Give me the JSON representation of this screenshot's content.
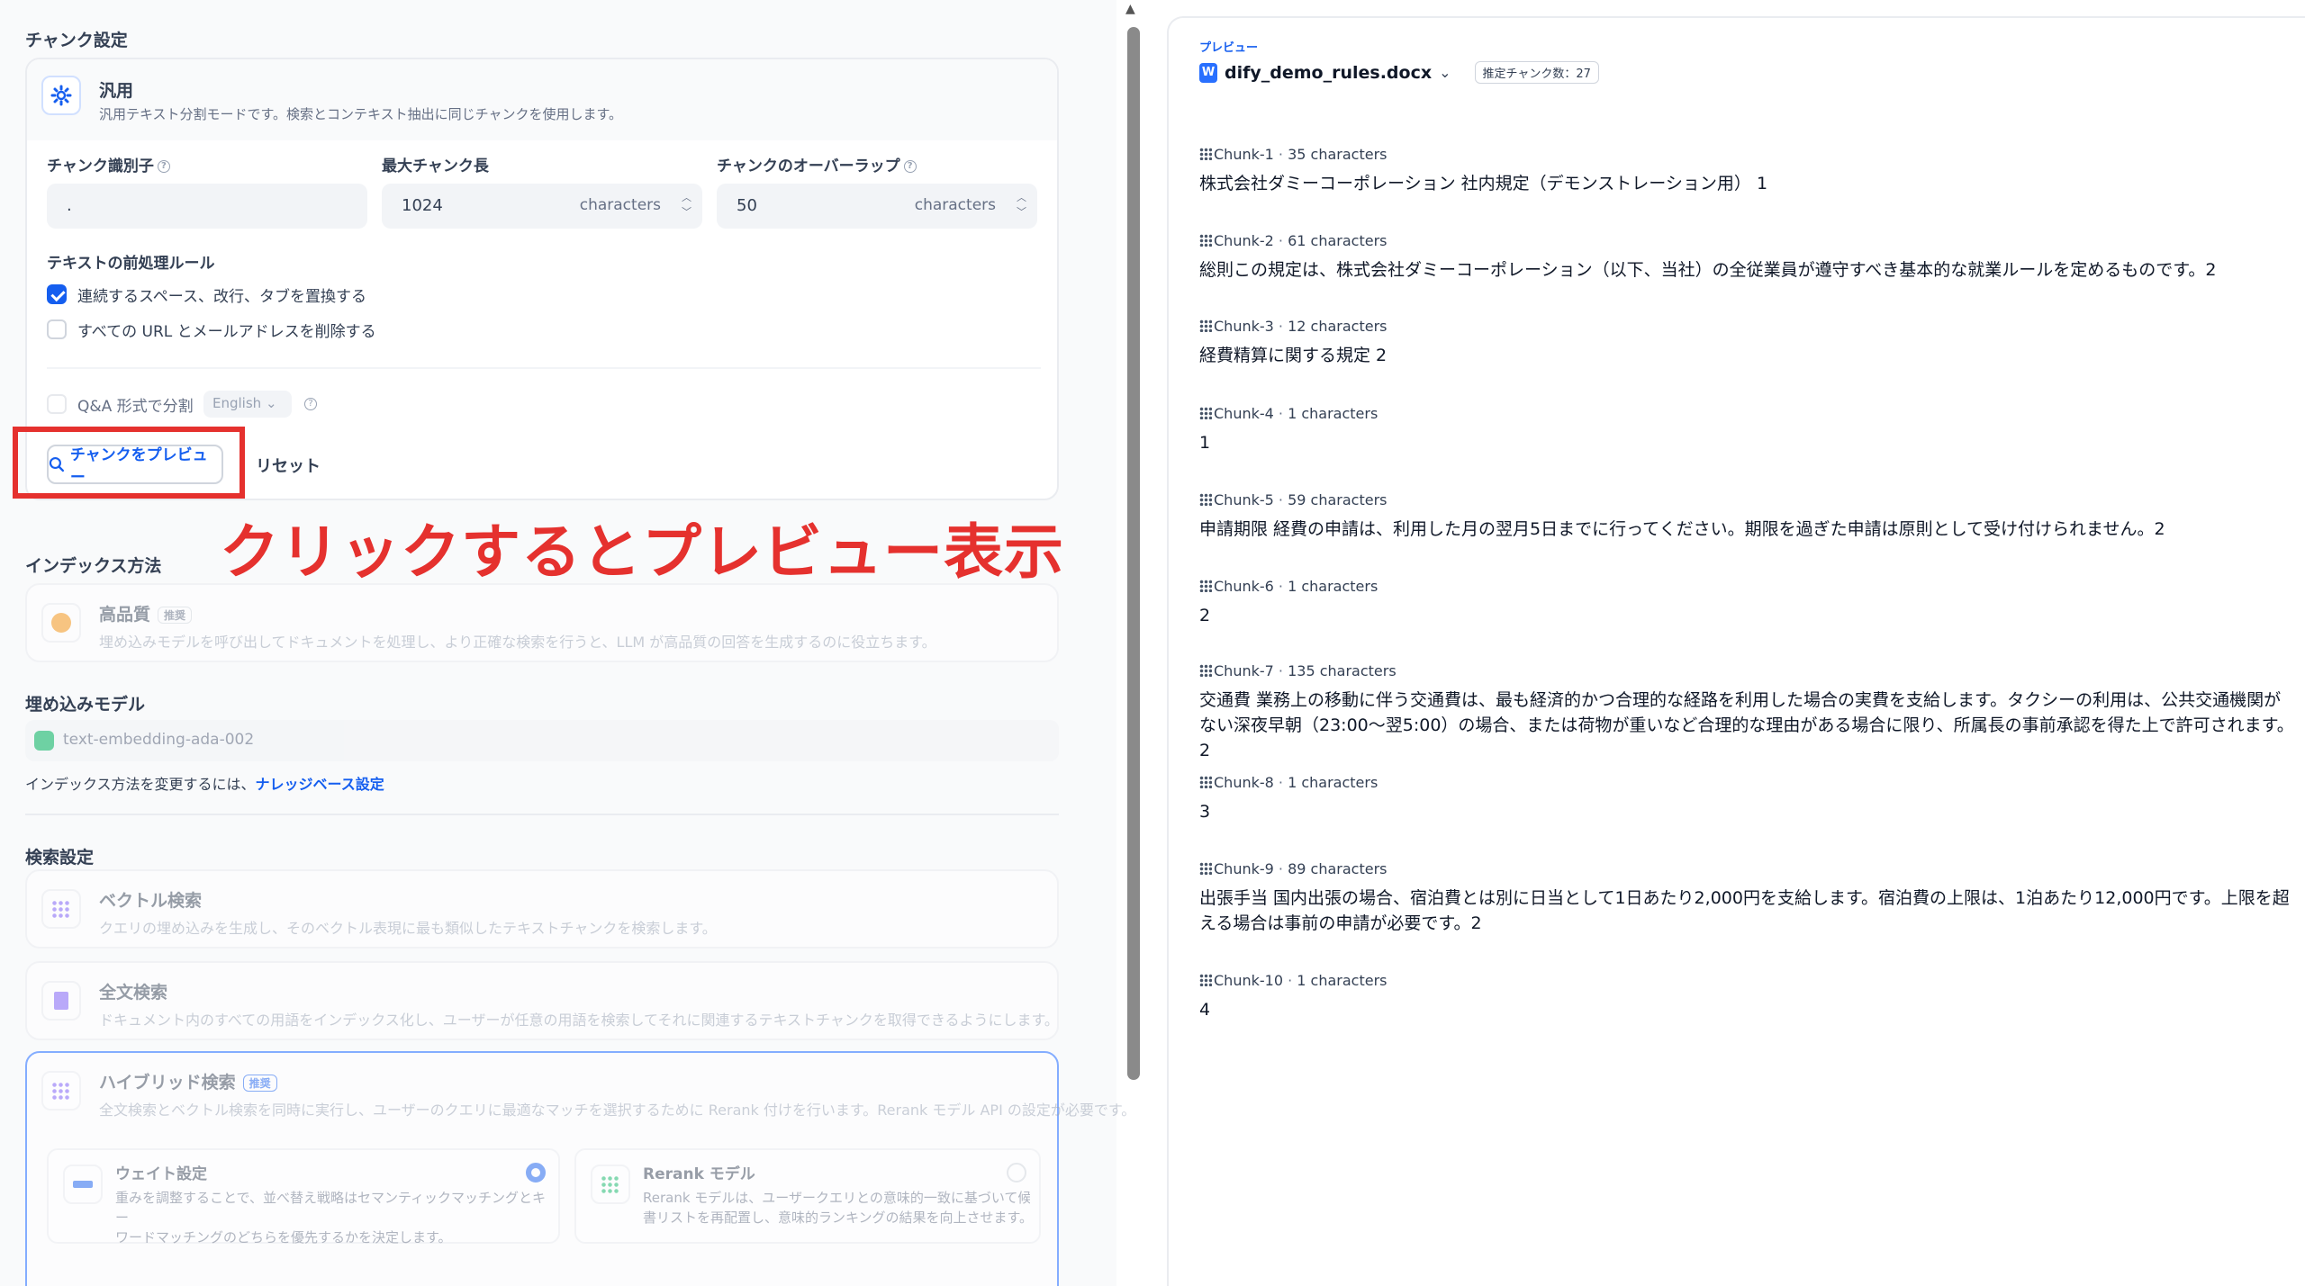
{
  "chunk_settings": {
    "section_title": "チャンク設定",
    "general": {
      "icon": "gear-icon",
      "title": "汎用",
      "desc": "汎用テキスト分割モードです。検索とコンテキスト抽出に同じチャンクを使用します。"
    },
    "delimiter": {
      "label": "チャンク識別子",
      "value": "."
    },
    "max_length": {
      "label": "最大チャンク長",
      "value": "1024",
      "unit": "characters"
    },
    "overlap": {
      "label": "チャンクのオーバーラップ",
      "value": "50",
      "unit": "characters"
    },
    "preprocess_title": "テキストの前処理ルール",
    "rule_spaces": {
      "label": "連続するスペース、改行、タブを置換する",
      "checked": true
    },
    "rule_urls": {
      "label": "すべての URL とメールアドレスを削除する",
      "checked": false
    },
    "qa": {
      "label": "Q&A 形式で分割",
      "language": "English"
    },
    "preview_button": "チャンクをプレビュー",
    "reset_button": "リセット"
  },
  "annotation": {
    "text": "クリックするとプレビュー表示",
    "color": "#e5312e"
  },
  "index_method": {
    "section_title": "インデックス方法",
    "high_quality": {
      "title": "高品質",
      "badge": "推奨",
      "desc": "埋め込みモデルを呼び出してドキュメントを処理し、より正確な検索を行うと、LLM が高品質の回答を生成するのに役立ちます。"
    }
  },
  "embedding": {
    "section_title": "埋め込みモデル",
    "model": "text-embedding-ada-002",
    "note_prefix": "インデックス方法を変更するには、",
    "note_link": "ナレッジベース設定"
  },
  "retrieval": {
    "section_title": "検索設定",
    "vector": {
      "title": "ベクトル検索",
      "desc": "クエリの埋め込みを生成し、そのベクトル表現に最も類似したテキストチャンクを検索します。"
    },
    "fulltext": {
      "title": "全文検索",
      "desc": "ドキュメント内のすべての用語をインデックス化し、ユーザーが任意の用語を検索してそれに関連するテキストチャンクを取得できるようにします。"
    },
    "hybrid": {
      "title": "ハイブリッド検索",
      "badge": "推奨",
      "desc": "全文検索とベクトル検索を同時に実行し、ユーザーのクエリに最適なマッチを選択するために Rerank 付けを行います。Rerank モデル API の設定が必要です。"
    },
    "weight": {
      "title": "ウェイト設定",
      "desc1": "重みを調整することで、並べ替え戦略はセマンティックマッチングとキー",
      "desc2": "ワードマッチングのどちらを優先するかを決定します。"
    },
    "rerank": {
      "title": "Rerank モデル",
      "desc1": "Rerank モデルは、ユーザークエリとの意味的一致に基づいて候補文",
      "desc2": "書リストを再配置し、意味的ランキングの結果を向上させます。"
    }
  },
  "preview": {
    "label": "プレビュー",
    "file": "dify_demo_rules.docx",
    "estimate": "推定チャンク数：27",
    "chunks": [
      {
        "title": "Chunk-1",
        "size": "35 characters",
        "text": "株式会社ダミーコーポレーション 社内規定（デモンストレーション用） 1"
      },
      {
        "title": "Chunk-2",
        "size": "61 characters",
        "text": "総則この規定は、株式会社ダミーコーポレーション（以下、当社）の全従業員が遵守すべき基本的な就業ルールを定めるものです。2"
      },
      {
        "title": "Chunk-3",
        "size": "12 characters",
        "text": "経費精算に関する規定 2"
      },
      {
        "title": "Chunk-4",
        "size": "1 characters",
        "text": "1"
      },
      {
        "title": "Chunk-5",
        "size": "59 characters",
        "text": "申請期限 経費の申請は、利用した月の翌月5日までに行ってください。期限を過ぎた申請は原則として受け付けられません。2"
      },
      {
        "title": "Chunk-6",
        "size": "1 characters",
        "text": "2"
      },
      {
        "title": "Chunk-7",
        "size": "135 characters",
        "text": "交通費 業務上の移動に伴う交通費は、最も経済的かつ合理的な経路を利用した場合の実費を支給します。タクシーの利用は、公共交通機関がない深夜早朝（23:00〜翌5:00）の場合、または荷物が重いなど合理的な理由がある場合に限り、所属長の事前承認を得た上で許可されます。2"
      },
      {
        "title": "Chunk-8",
        "size": "1 characters",
        "text": "3"
      },
      {
        "title": "Chunk-9",
        "size": "89 characters",
        "text": "出張手当 国内出張の場合、宿泊費とは別に日当として1日あたり2,000円を支給します。宿泊費の上限は、1泊あたり12,000円です。上限を超える場合は事前の申請が必要です。2"
      },
      {
        "title": "Chunk-10",
        "size": "1 characters",
        "text": "4"
      }
    ]
  }
}
